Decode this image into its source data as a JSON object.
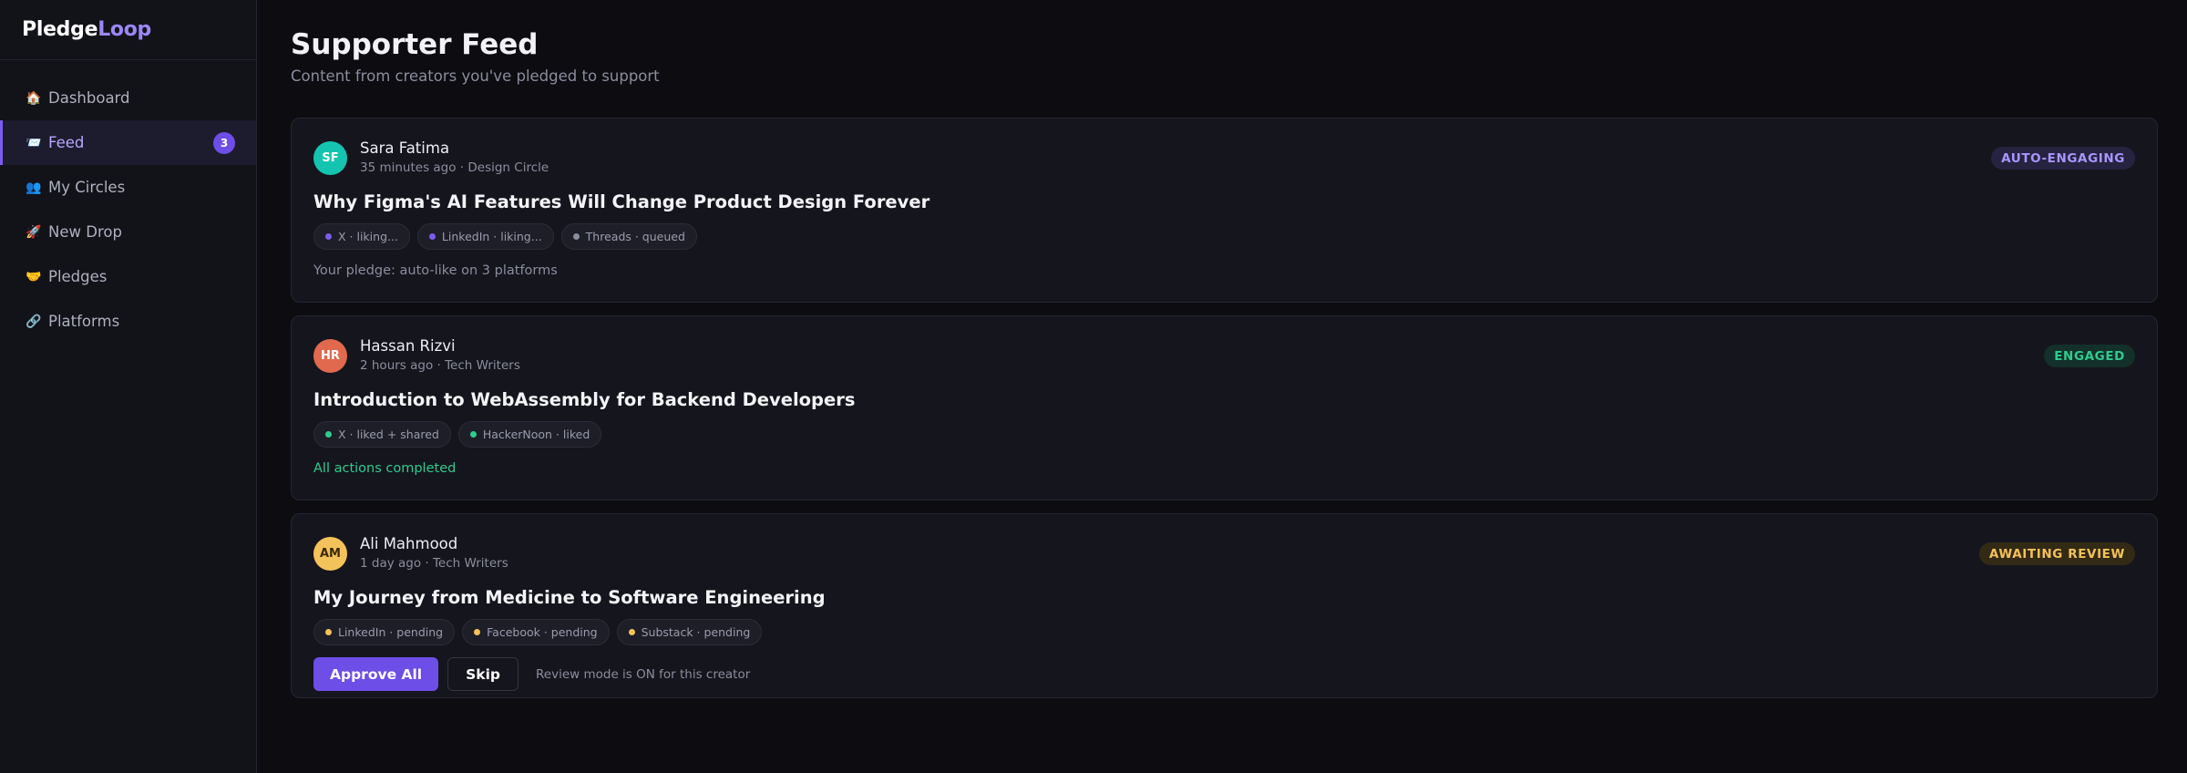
{
  "app": {
    "logo_a": "Pledge",
    "logo_b": "Loop"
  },
  "sidebar": {
    "items": [
      {
        "icon": "🏠",
        "icon_name": "house-icon",
        "label": "Dashboard"
      },
      {
        "icon": "📨",
        "icon_name": "inbox-icon",
        "label": "Feed",
        "badge": "3",
        "active": true
      },
      {
        "icon": "👥",
        "icon_name": "people-icon",
        "label": "My Circles"
      },
      {
        "icon": "🚀",
        "icon_name": "rocket-icon",
        "label": "New Drop"
      },
      {
        "icon": "🤝",
        "icon_name": "handshake-icon",
        "label": "Pledges"
      },
      {
        "icon": "🔗",
        "icon_name": "link-icon",
        "label": "Platforms"
      }
    ]
  },
  "header": {
    "title": "Supporter Feed",
    "subtitle": "Content from creators you've pledged to support"
  },
  "colors": {
    "accent": "#6d4ee6",
    "success": "#2fcb8f",
    "warning": "#f4c25a",
    "pending_dot": "#8b8d9e"
  },
  "posts": [
    {
      "initials": "SF",
      "avatar_color": "#14c4b0",
      "author": "Sara Fatima",
      "meta": "35 minutes ago · Design Circle",
      "status": "AUTO-ENGAGING",
      "title": "Why Figma's AI Features Will Change Product Design Forever",
      "chips": [
        {
          "label": "X · liking...",
          "dot": "#7c5cf0"
        },
        {
          "label": "LinkedIn · liking...",
          "dot": "#7c5cf0"
        },
        {
          "label": "Threads · queued",
          "dot": "#8b8d9e"
        }
      ],
      "note": "Your pledge: auto-like on 3 platforms"
    },
    {
      "initials": "HR",
      "avatar_color": "#e0694e",
      "author": "Hassan Rizvi",
      "meta": "2 hours ago · Tech Writers",
      "status": "ENGAGED",
      "title": "Introduction to WebAssembly for Backend Developers",
      "chips": [
        {
          "label": "X · liked + shared",
          "dot": "#2fcb8f"
        },
        {
          "label": "HackerNoon · liked",
          "dot": "#2fcb8f"
        }
      ],
      "note": "All actions completed"
    },
    {
      "initials": "AM",
      "avatar_color": "#f4c25a",
      "author": "Ali Mahmood",
      "meta": "1 day ago · Tech Writers",
      "status": "AWAITING REVIEW",
      "title": "My Journey from Medicine to Software Engineering",
      "chips": [
        {
          "label": "LinkedIn · pending",
          "dot": "#f4c25a"
        },
        {
          "label": "Facebook · pending",
          "dot": "#f4c25a"
        },
        {
          "label": "Substack · pending",
          "dot": "#f4c25a"
        }
      ],
      "approve_label": "Approve All",
      "skip_label": "Skip",
      "hint": "Review mode is ON for this creator"
    }
  ]
}
